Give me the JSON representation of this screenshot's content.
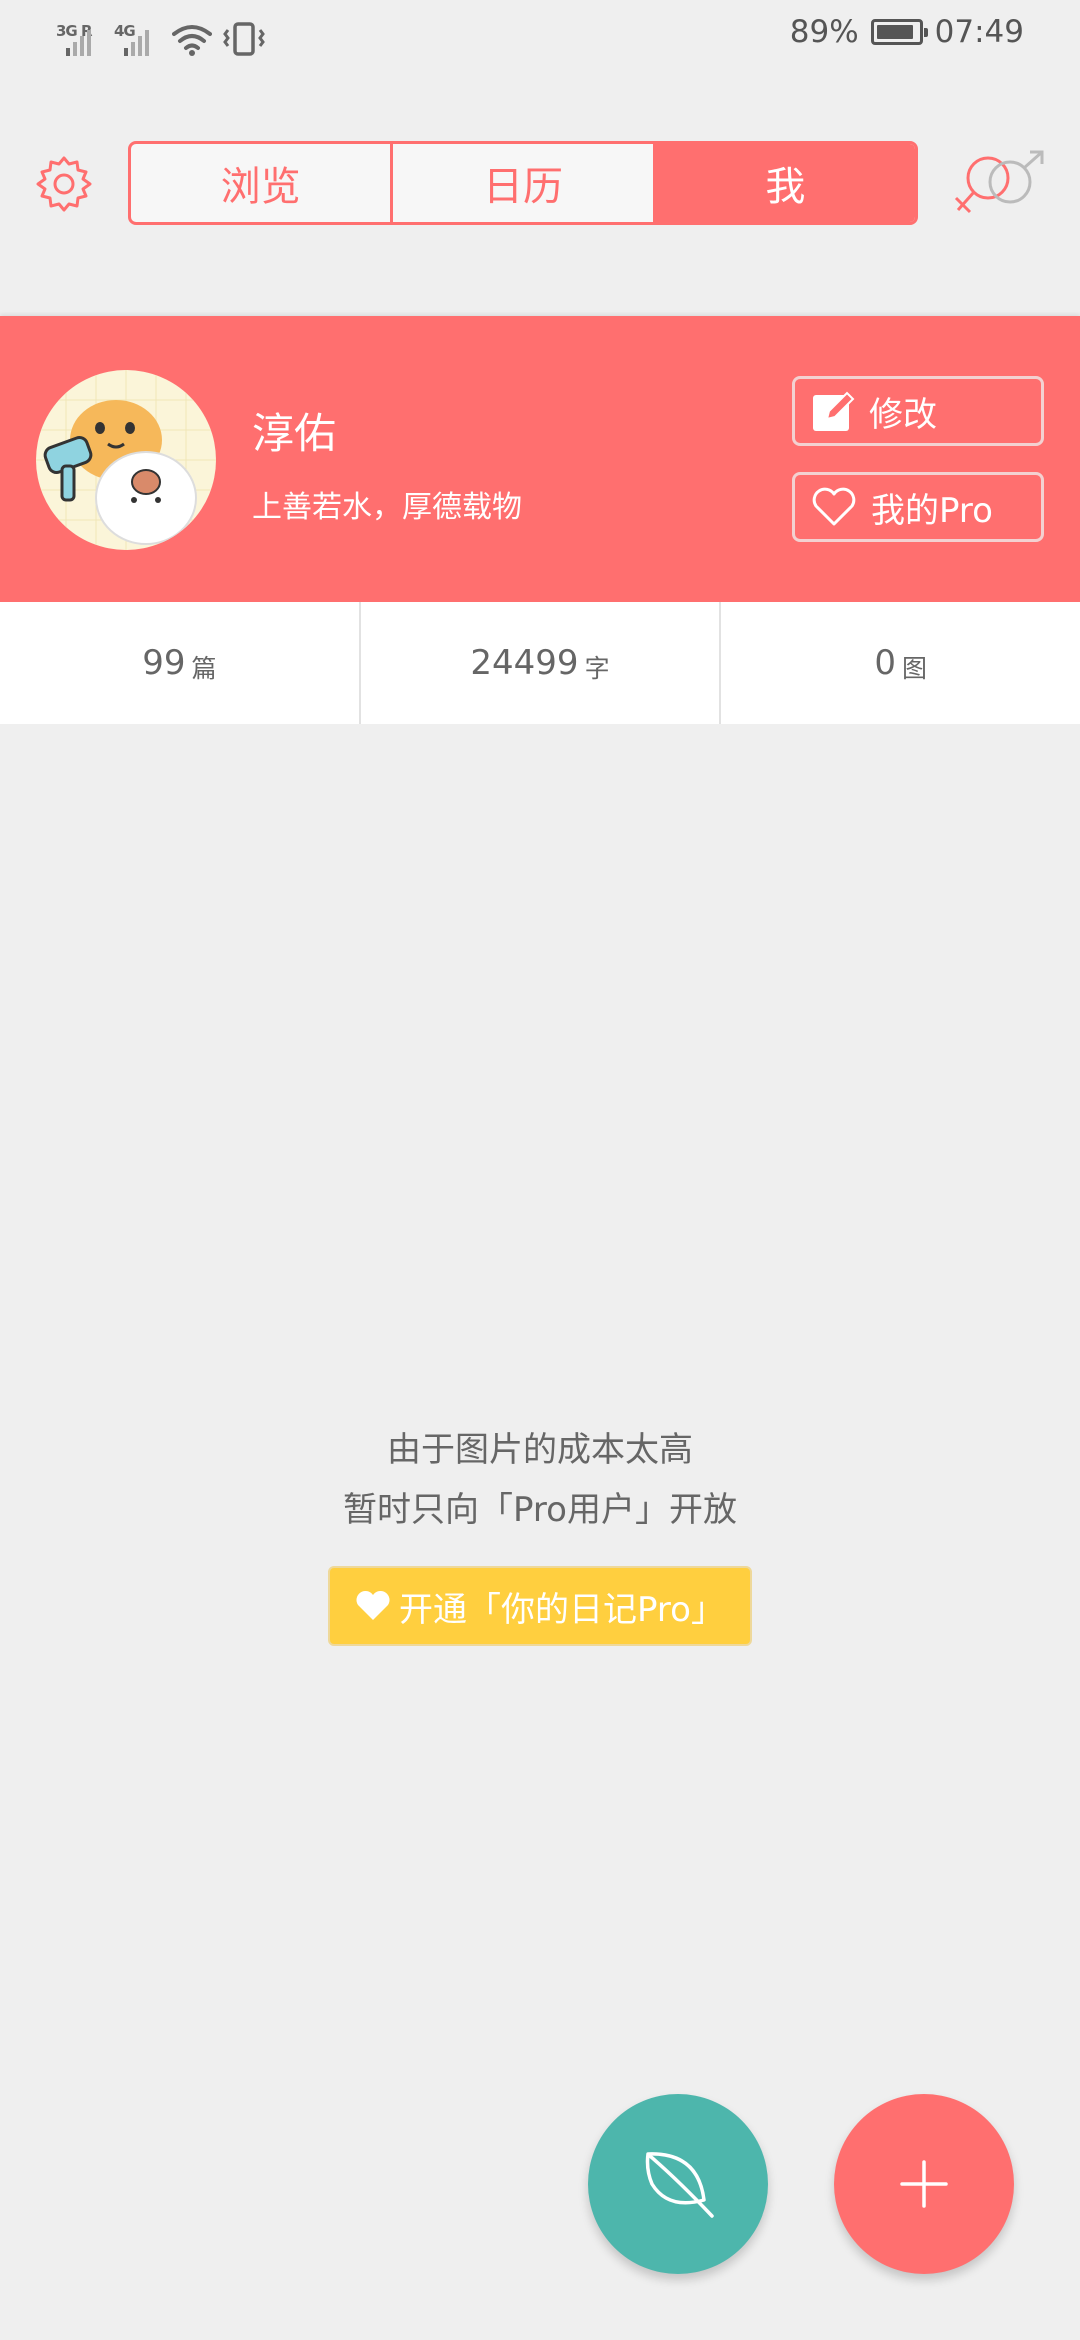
{
  "status_bar": {
    "network1": "3G R",
    "network2": "4G",
    "battery": "89%",
    "time": "07:49"
  },
  "nav": {
    "tabs": [
      {
        "label": "浏览",
        "active": false
      },
      {
        "label": "日历",
        "active": false
      },
      {
        "label": "我",
        "active": true
      }
    ],
    "settings_icon": "gear-icon",
    "gender_icon": "gender-symbol-icon"
  },
  "profile": {
    "name": "淳佑",
    "motto": "上善若水，厚德载物",
    "edit_label": "修改",
    "pro_label": "我的Pro"
  },
  "stats": [
    {
      "value": "99",
      "unit": "篇"
    },
    {
      "value": "24499",
      "unit": "字"
    },
    {
      "value": "0",
      "unit": "图"
    }
  ],
  "notice": {
    "line1": "由于图片的成本太高",
    "line2": "暂时只向「Pro用户」开放",
    "cta": "开通「你的日记Pro」"
  },
  "colors": {
    "accent": "#ff6f6f",
    "teal": "#4db6ac",
    "gold": "#ffcf3f",
    "background": "#efefef"
  }
}
